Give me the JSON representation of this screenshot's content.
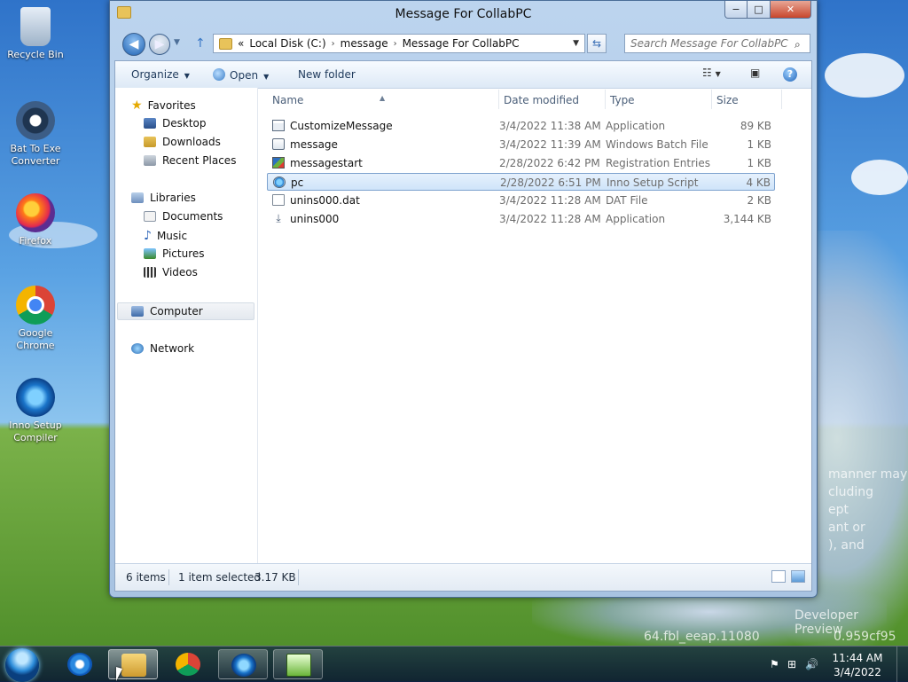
{
  "desktop": {
    "icons": [
      {
        "label": "Recycle Bin",
        "icon": "recycle-bin-icon"
      },
      {
        "label": "Bat To Exe Converter",
        "icon": "gear-icon"
      },
      {
        "label": "Firefox",
        "icon": "firefox-icon"
      },
      {
        "label": "Google Chrome",
        "icon": "chrome-icon"
      },
      {
        "label": "Inno Setup Compiler",
        "icon": "inno-setup-icon"
      }
    ],
    "watermark": {
      "line1": "manner may",
      "line2": "cluding",
      "line3": "ept",
      "line4": "ant or",
      "line5": "), and",
      "line6": "Developer Preview",
      "line7": "64.fbl_eeap.11080",
      "line8": "0.959cf95"
    }
  },
  "window": {
    "title": "Message For CollabPC",
    "controls": {
      "minimize": "−",
      "maximize": "□",
      "close": "✕"
    },
    "address": {
      "prefix": "«",
      "parts": [
        "Local Disk (C:)",
        "message",
        "Message For CollabPC"
      ]
    },
    "search_placeholder": "Search Message For CollabPC",
    "toolbar": {
      "organize": "Organize",
      "open": "Open",
      "new_folder": "New folder"
    },
    "nav": {
      "favorites": "Favorites",
      "desktop": "Desktop",
      "downloads": "Downloads",
      "recent_places": "Recent Places",
      "libraries": "Libraries",
      "documents": "Documents",
      "music": "Music",
      "pictures": "Pictures",
      "videos": "Videos",
      "computer": "Computer",
      "network": "Network"
    },
    "columns": {
      "name": "Name",
      "date": "Date modified",
      "type": "Type",
      "size": "Size"
    },
    "files": [
      {
        "name": "CustomizeMessage",
        "date": "3/4/2022 11:38 AM",
        "type": "Application",
        "size": "89 KB",
        "icon": "application-icon"
      },
      {
        "name": "message",
        "date": "3/4/2022 11:39 AM",
        "type": "Windows Batch File",
        "size": "1 KB",
        "icon": "batch-file-icon"
      },
      {
        "name": "messagestart",
        "date": "2/28/2022 6:42 PM",
        "type": "Registration Entries",
        "size": "1 KB",
        "icon": "registry-icon"
      },
      {
        "name": "pc",
        "date": "2/28/2022 6:51 PM",
        "type": "Inno Setup Script",
        "size": "4 KB",
        "icon": "inno-script-icon"
      },
      {
        "name": "unins000.dat",
        "date": "3/4/2022 11:28 AM",
        "type": "DAT File",
        "size": "2 KB",
        "icon": "dat-file-icon"
      },
      {
        "name": "unins000",
        "date": "3/4/2022 11:28 AM",
        "type": "Application",
        "size": "3,144 KB",
        "icon": "uninstall-icon"
      }
    ],
    "status": {
      "count": "6 items",
      "selection": "1 item selected",
      "size": "3.17 KB"
    }
  },
  "taskbar": {
    "apps": [
      "internet-explorer-icon",
      "file-explorer-icon",
      "chrome-icon",
      "inno-setup-icon",
      "notepad-plus-icon"
    ],
    "clock_time": "11:44 AM",
    "clock_date": "3/4/2022"
  }
}
